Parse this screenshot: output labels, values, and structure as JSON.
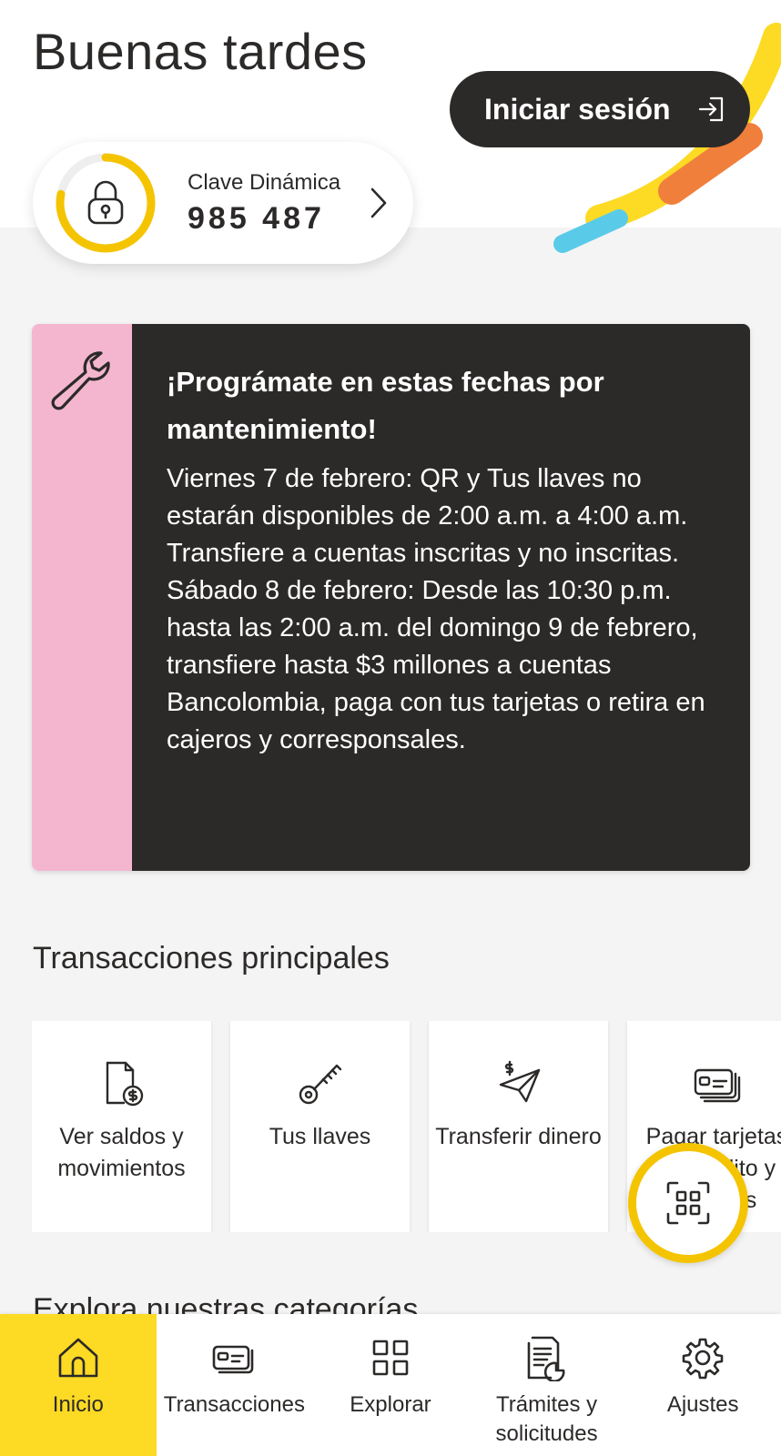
{
  "header": {
    "greeting": "Buenas tardes",
    "login_label": "Iniciar sesión"
  },
  "clave": {
    "label": "Clave Dinámica",
    "code": "985 487",
    "progress": 0.78,
    "ring_color": "#f5c400"
  },
  "banner": {
    "title": "¡Prográmate en estas fechas por mantenimiento!",
    "paragraph_1": "Viernes 7 de febrero: QR y Tus llaves no estarán disponibles de 2:00 a.m. a 4:00 a.m. Transfiere a cuentas inscritas y no inscritas.",
    "paragraph_2": "Sábado 8 de febrero: Desde las 10:30 p.m. hasta las 2:00 a.m. del domingo 9 de febrero, transfiere hasta $3 millones a cuentas Bancolombia, paga con tus tarjetas o retira en cajeros y corresponsales.",
    "side_color": "#f4b6cf",
    "icon": "wrench-icon"
  },
  "transactions": {
    "title": "Transacciones principales",
    "items": [
      {
        "label": "Ver saldos y movimientos",
        "icon": "statement-icon"
      },
      {
        "label": "Tus llaves",
        "icon": "key-icon"
      },
      {
        "label": "Transferir dinero",
        "icon": "send-money-icon"
      },
      {
        "label": "Pagar tarjetas de crédito y créditos",
        "icon": "card-icon"
      }
    ]
  },
  "explore": {
    "title": "Explora nuestras categorías"
  },
  "nav": {
    "items": [
      {
        "label": "Inicio",
        "icon": "home-icon",
        "active": true
      },
      {
        "label": "Transacciones",
        "icon": "transactions-icon"
      },
      {
        "label": "Explorar",
        "icon": "grid-icon"
      },
      {
        "label": "Trámites y solicitudes",
        "icon": "documents-icon"
      },
      {
        "label": "Ajustes",
        "icon": "gear-icon"
      }
    ],
    "active_color": "#fdda24"
  }
}
